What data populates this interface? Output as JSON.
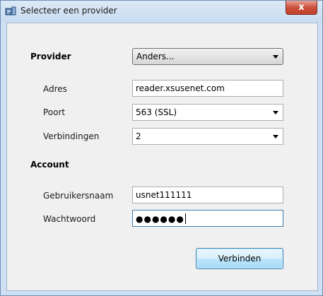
{
  "window": {
    "title": "Selecteer een provider",
    "close_glyph": "x"
  },
  "provider": {
    "section_label": "Provider",
    "selected": "Anders..."
  },
  "server": {
    "address_label": "Adres",
    "address_value": "reader.xsusenet.com",
    "port_label": "Poort",
    "port_selected": "563 (SSL)",
    "connections_label": "Verbindingen",
    "connections_selected": "2"
  },
  "account": {
    "section_label": "Account",
    "username_label": "Gebruikersnaam",
    "username_value": "usnet111111",
    "password_label": "Wachtwoord",
    "password_masked": "●●●●●●"
  },
  "actions": {
    "connect_label": "Verbinden"
  },
  "colors": {
    "frame": "#cfe0f3",
    "client_bg": "#f0f0f0",
    "close_red": "#c94c36",
    "button_border": "#3c7fb1"
  },
  "icons": {
    "app": "newsreader-app-icon",
    "dropdown": "chevron-down-icon",
    "close": "close-icon"
  }
}
